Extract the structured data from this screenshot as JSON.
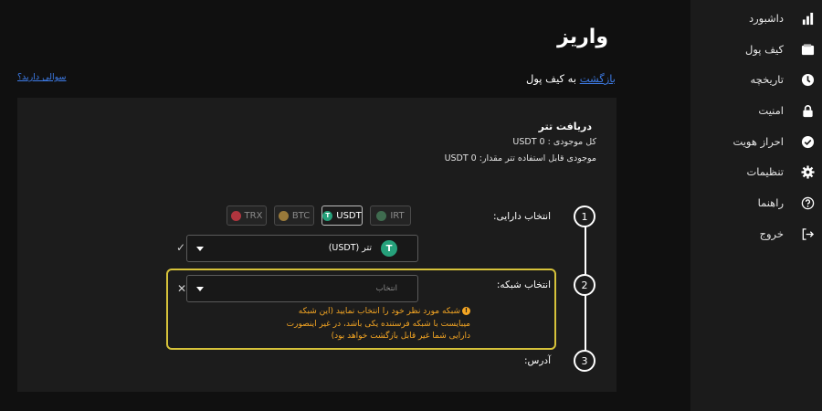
{
  "sidebar": {
    "items": [
      {
        "label": "داشبورد",
        "icon": "bar-chart-icon"
      },
      {
        "label": "کیف پول",
        "icon": "wallet-icon"
      },
      {
        "label": "تاریخچه",
        "icon": "history-icon"
      },
      {
        "label": "امنیت",
        "icon": "lock-icon"
      },
      {
        "label": "احراز هویت",
        "icon": "verified-check-icon"
      },
      {
        "label": "تنظیمات",
        "icon": "gear-icon"
      },
      {
        "label": "راهنما",
        "icon": "help-icon"
      },
      {
        "label": "خروج",
        "icon": "logout-icon"
      }
    ]
  },
  "header": {
    "title": "واریز",
    "back_link": "بازگشت",
    "back_suffix": "به کیف پول",
    "help_link": "سوالی دارید؟"
  },
  "asset": {
    "title": "دریافت تتر",
    "total_balance": "کل موجودی : USDT 0",
    "usable_balance": "موجودی قابل استفاده تتر مقدار: USDT 0"
  },
  "steps": {
    "step1": {
      "number": "1",
      "label": "انتخاب دارایی:"
    },
    "step2": {
      "number": "2",
      "label": "انتخاب شبکه:"
    },
    "step3": {
      "number": "3",
      "label": "آدرس:"
    }
  },
  "chips": [
    {
      "label": "TRX",
      "active": false
    },
    {
      "label": "BTC",
      "active": false
    },
    {
      "label": "USDT",
      "active": true
    },
    {
      "label": "IRT",
      "active": false
    }
  ],
  "asset_select": {
    "value": "تتر (USDT)"
  },
  "network_select": {
    "placeholder": "انتخاب"
  },
  "warning_text": "شبکه مورد نظر خود را انتخاب نمایید (این شبکه میبایست با شبکه فرستنده یکی باشد، در غیر اینصورت دارایی شما غیر قابل بازگشت خواهد بود)",
  "colors": {
    "accent_link": "#3d7be6",
    "warning": "#f5a623",
    "highlight_border": "#d6c23a",
    "tether_green": "#26a17b"
  }
}
